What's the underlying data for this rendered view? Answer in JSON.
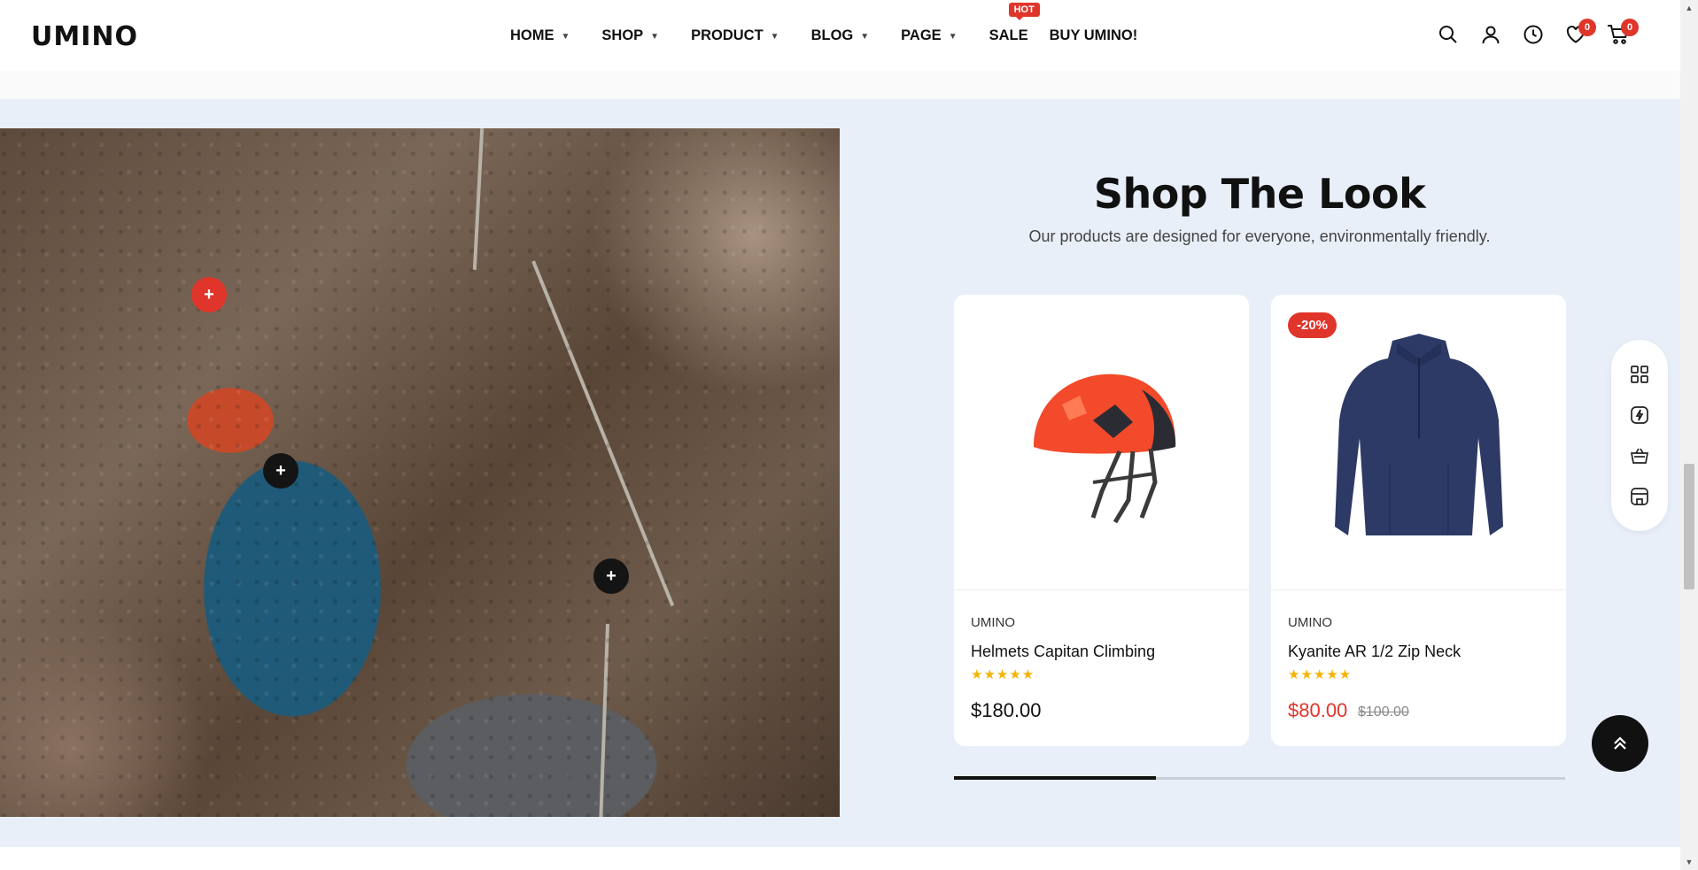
{
  "header": {
    "logo": "UMINO",
    "nav": [
      {
        "label": "HOME",
        "has_dropdown": true
      },
      {
        "label": "SHOP",
        "has_dropdown": true
      },
      {
        "label": "PRODUCT",
        "has_dropdown": true
      },
      {
        "label": "BLOG",
        "has_dropdown": true
      },
      {
        "label": "PAGE",
        "has_dropdown": true
      },
      {
        "label": "SALE",
        "has_dropdown": false,
        "badge": "HOT"
      },
      {
        "label": "BUY UMINO!",
        "has_dropdown": false
      }
    ],
    "icons": [
      "search-icon",
      "user-icon",
      "clock-icon",
      "heart-icon",
      "cart-icon"
    ],
    "wishlist_count": "0",
    "cart_count": "0"
  },
  "section": {
    "title": "Shop The Look",
    "subtitle": "Our products are designed for everyone, environmentally friendly.",
    "hotspots": [
      "+",
      "+",
      "+"
    ],
    "products": [
      {
        "brand": "UMINO",
        "name": "Helmets Capitan Climbing",
        "rating": "★★★★★",
        "price": "$180.00"
      },
      {
        "brand": "UMINO",
        "name": "Kyanite AR 1/2 Zip Neck",
        "rating": "★★★★★",
        "price": "$80.00",
        "old_price": "$100.00",
        "discount": "-20%"
      }
    ],
    "slider_progress": 0.33
  },
  "side_toolbar": [
    "grid-icon",
    "flash-icon",
    "basket-icon",
    "store-icon"
  ],
  "back_to_top": "⌃",
  "colors": {
    "accent": "#e0352b",
    "section_bg": "#e8eff9",
    "star": "#f5b301"
  }
}
